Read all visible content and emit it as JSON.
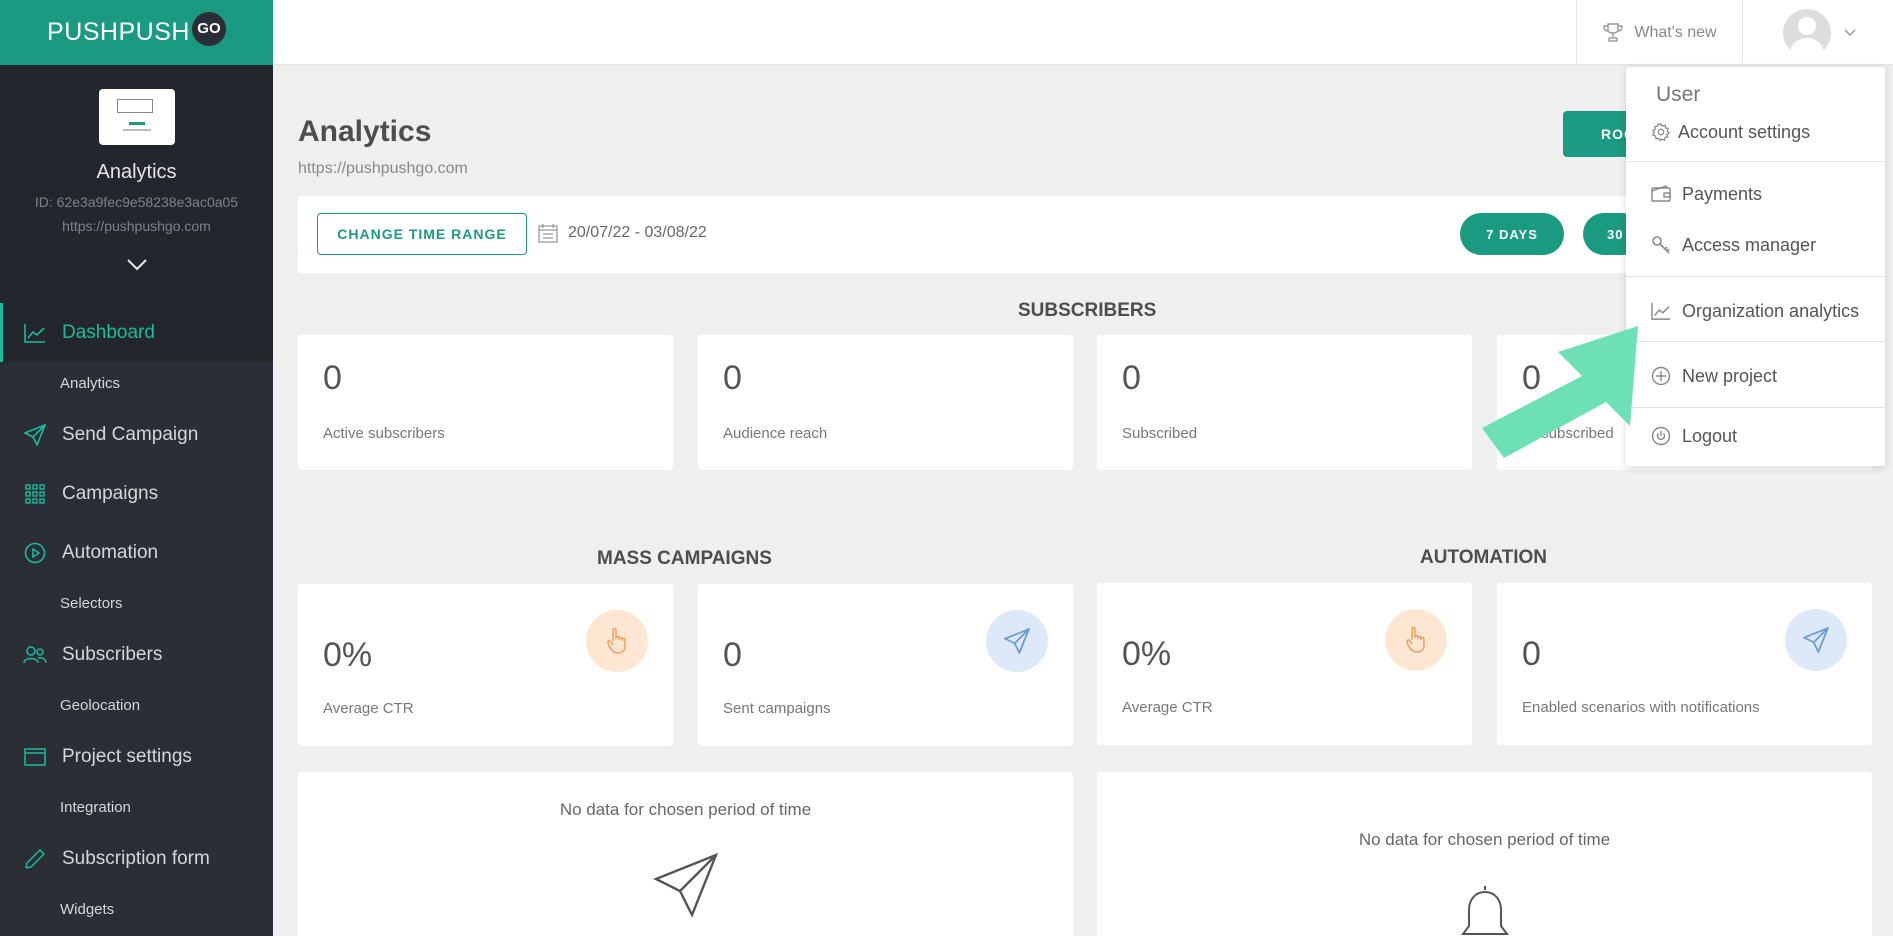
{
  "logo": {
    "text": "PUSHPUSH",
    "badge": "GO"
  },
  "project": {
    "name": "Analytics",
    "id": "ID: 62e3a9fec9e58238e3ac0a05",
    "url": "https://pushpushgo.com"
  },
  "nav": {
    "dashboard": "Dashboard",
    "analytics": "Analytics",
    "send_campaign": "Send Campaign",
    "campaigns": "Campaigns",
    "automation": "Automation",
    "selectors": "Selectors",
    "subscribers": "Subscribers",
    "geolocation": "Geolocation",
    "project_settings": "Project settings",
    "integration": "Integration",
    "subscription_form": "Subscription form",
    "widgets": "Widgets"
  },
  "topbar": {
    "whats_new": "What's new"
  },
  "page": {
    "title": "Analytics",
    "url": "https://pushpushgo.com",
    "rocket_btn": "ROC"
  },
  "range": {
    "change_btn": "CHANGE TIME RANGE",
    "dates": "20/07/22 - 03/08/22",
    "pill_7": "7 DAYS",
    "pill_30": "30"
  },
  "subscribers": {
    "title": "SUBSCRIBERS",
    "cards": [
      {
        "value": "0",
        "label": "Active subscribers"
      },
      {
        "value": "0",
        "label": "Audience reach"
      },
      {
        "value": "0",
        "label": "Subscribed"
      },
      {
        "value": "0",
        "label": "Unsubscribed"
      }
    ]
  },
  "mass": {
    "title": "MASS CAMPAIGNS",
    "cards": [
      {
        "value": "0%",
        "label": "Average CTR"
      },
      {
        "value": "0",
        "label": "Sent campaigns"
      }
    ]
  },
  "automation": {
    "title": "AUTOMATION",
    "cards": [
      {
        "value": "0%",
        "label": "Average CTR"
      },
      {
        "value": "0",
        "label": "Enabled scenarios with notifications"
      }
    ]
  },
  "nodata": {
    "left": "No data for chosen period of time",
    "right": "No data for chosen period of time"
  },
  "dropdown": {
    "title": "User",
    "account_settings": "Account settings",
    "payments": "Payments",
    "access_manager": "Access manager",
    "org_analytics": "Organization analytics",
    "new_project": "New project",
    "logout": "Logout"
  },
  "colors": {
    "brand": "#1a9a80",
    "sidebar": "#2b2e37",
    "accent_active": "#1abc9c",
    "arrow": "#6ee0b5"
  }
}
